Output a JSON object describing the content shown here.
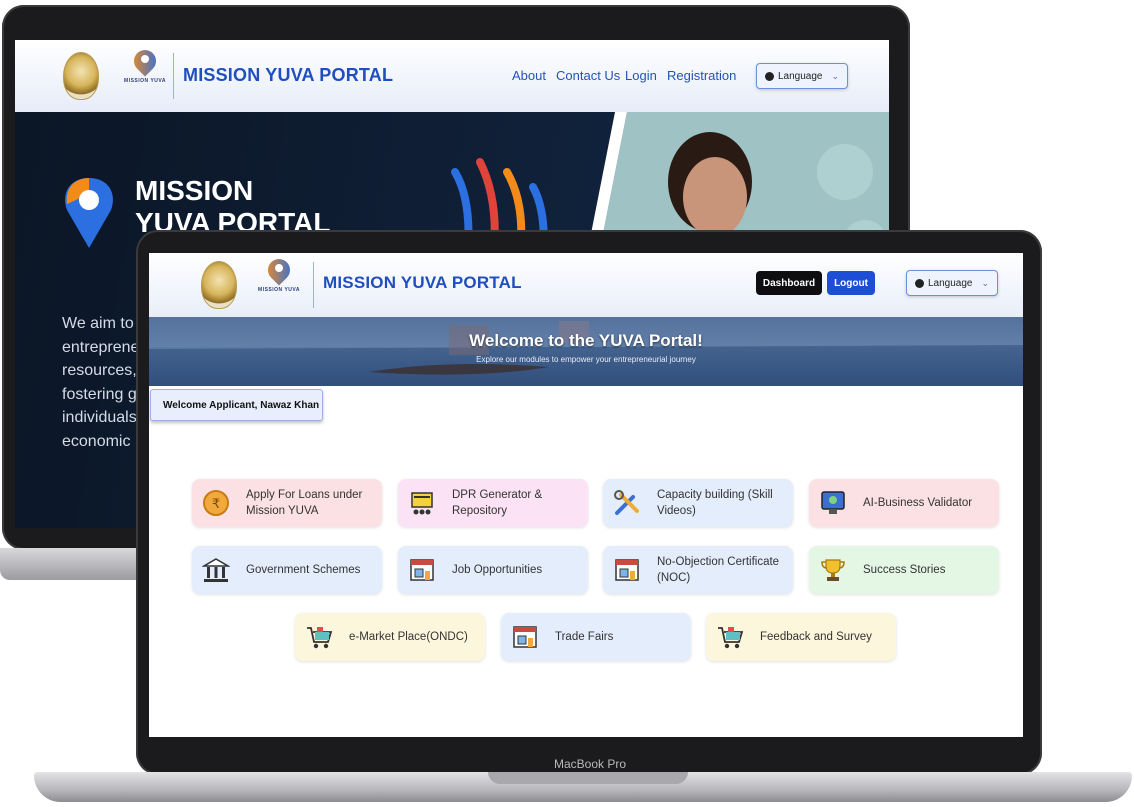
{
  "back_screen": {
    "brand": "MISSION YUVA PORTAL",
    "logo_small_text": "MISSION YUVA",
    "nav_links": [
      "About",
      "Contact Us",
      "Login",
      "Registration"
    ],
    "language_label": "Language",
    "hero_title_line1": "MISSION",
    "hero_title_line2": "YUVA PORTAL",
    "hero_text_lines": [
      "We aim to",
      "entreprene",
      "resources,",
      "fostering g",
      "individuals",
      "economic"
    ]
  },
  "front_screen": {
    "brand": "MISSION YUVA PORTAL",
    "logo_small_text": "MISSION YUVA",
    "dashboard_button": "Dashboard",
    "logout_button": "Logout",
    "language_label": "Language",
    "banner_title": "Welcome to the YUVA Portal!",
    "banner_subtitle": "Explore our modules to empower your entrepreneurial journey",
    "welcome_text": "Welcome Applicant, Nawaz Khan",
    "modules": [
      {
        "label": "Apply For Loans under Mission YUVA",
        "icon": "rupee-coin-icon"
      },
      {
        "label": "DPR Generator & Repository",
        "icon": "dpr-cart-icon"
      },
      {
        "label": "Capacity building (Skill Videos)",
        "icon": "tools-icon"
      },
      {
        "label": "AI-Business Validator",
        "icon": "ai-monitor-icon"
      },
      {
        "label": "Government Schemes",
        "icon": "government-building-icon"
      },
      {
        "label": "Job Opportunities",
        "icon": "job-store-icon"
      },
      {
        "label": "No-Objection Certificate (NOC)",
        "icon": "noc-store-icon"
      },
      {
        "label": "Success Stories",
        "icon": "trophy-icon"
      },
      {
        "label": "e-Market Place(ONDC)",
        "icon": "shopping-cart-icon"
      },
      {
        "label": "Trade Fairs",
        "icon": "trade-store-icon"
      },
      {
        "label": "Feedback and Survey",
        "icon": "feedback-cart-icon"
      }
    ]
  },
  "device": {
    "label": "MacBook Pro"
  },
  "colors": {
    "brand_blue": "#1f4fbf",
    "logout_blue": "#1d4fd6",
    "dashboard_black": "#0e0e10",
    "logo_orange": "#f38b1b"
  }
}
